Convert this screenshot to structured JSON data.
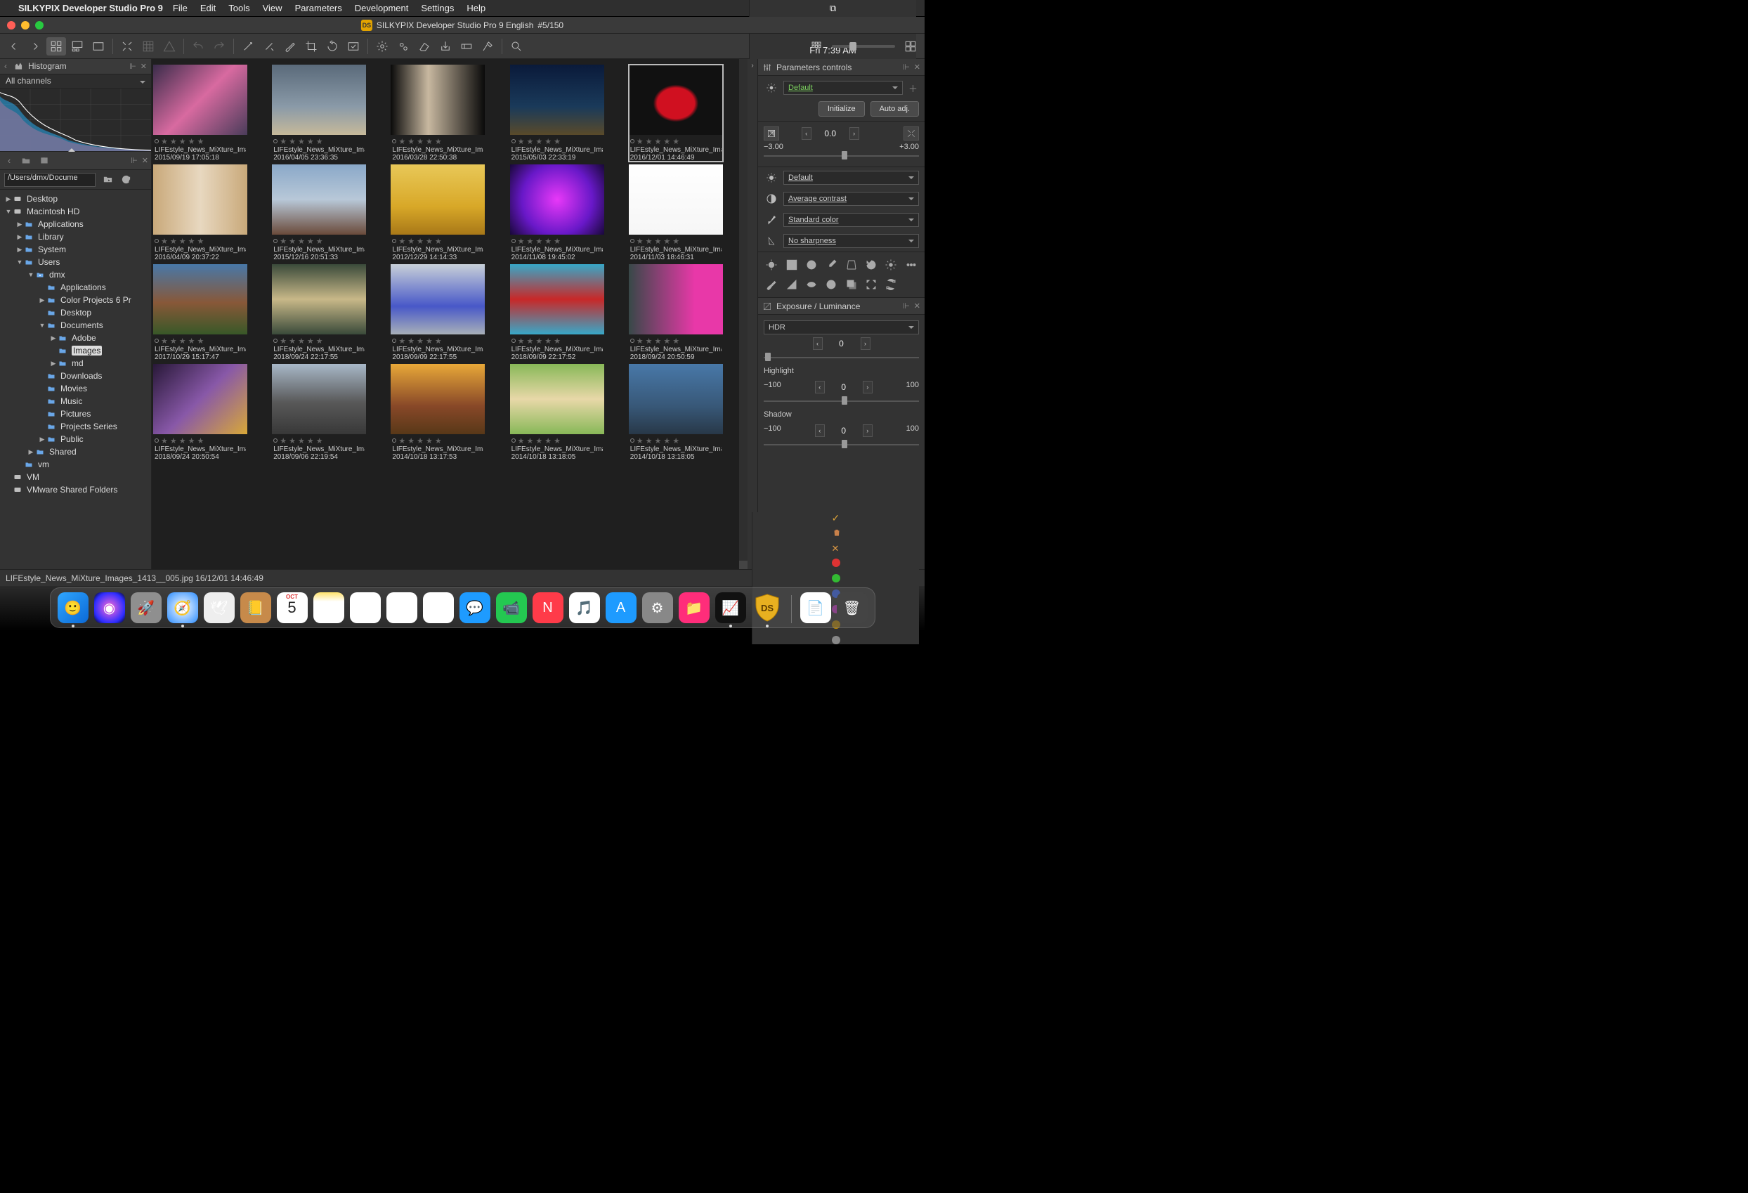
{
  "menubar": {
    "apple": "",
    "app": "SILKYPIX Developer Studio Pro 9",
    "items": [
      "File",
      "Edit",
      "Tools",
      "View",
      "Parameters",
      "Development",
      "Settings",
      "Help"
    ],
    "clock": "Fri 7:39 AM"
  },
  "titlebar": {
    "title": "SILKYPIX Developer Studio Pro 9 English",
    "counter": "#5/150",
    "appicon": "DS"
  },
  "left": {
    "histogram": {
      "title": "Histogram",
      "mode": "All channels"
    },
    "path": "/Users/dmx/Docume",
    "tree": [
      {
        "d": 0,
        "a": "▶",
        "t": "disk",
        "l": "Desktop"
      },
      {
        "d": 0,
        "a": "▼",
        "t": "disk",
        "l": "Macintosh HD"
      },
      {
        "d": 1,
        "a": "▶",
        "t": "folder",
        "l": "Applications"
      },
      {
        "d": 1,
        "a": "▶",
        "t": "folder",
        "l": "Library"
      },
      {
        "d": 1,
        "a": "▶",
        "t": "folder",
        "l": "System"
      },
      {
        "d": 1,
        "a": "▼",
        "t": "folder",
        "l": "Users"
      },
      {
        "d": 2,
        "a": "▼",
        "t": "user",
        "l": "dmx"
      },
      {
        "d": 3,
        "a": "",
        "t": "folder",
        "l": "Applications"
      },
      {
        "d": 3,
        "a": "▶",
        "t": "folder",
        "l": "Color Projects 6 Pr"
      },
      {
        "d": 3,
        "a": "",
        "t": "folder",
        "l": "Desktop"
      },
      {
        "d": 3,
        "a": "▼",
        "t": "folder",
        "l": "Documents"
      },
      {
        "d": 4,
        "a": "▶",
        "t": "folder",
        "l": "Adobe"
      },
      {
        "d": 4,
        "a": "",
        "t": "folder",
        "l": "Images",
        "sel": true
      },
      {
        "d": 4,
        "a": "▶",
        "t": "folder",
        "l": "md"
      },
      {
        "d": 3,
        "a": "",
        "t": "folder",
        "l": "Downloads"
      },
      {
        "d": 3,
        "a": "",
        "t": "folder",
        "l": "Movies"
      },
      {
        "d": 3,
        "a": "",
        "t": "folder",
        "l": "Music"
      },
      {
        "d": 3,
        "a": "",
        "t": "folder",
        "l": "Pictures"
      },
      {
        "d": 3,
        "a": "",
        "t": "folder",
        "l": "Projects Series"
      },
      {
        "d": 3,
        "a": "▶",
        "t": "folder",
        "l": "Public"
      },
      {
        "d": 2,
        "a": "▶",
        "t": "folder",
        "l": "Shared"
      },
      {
        "d": 1,
        "a": "",
        "t": "folder",
        "l": "vm"
      },
      {
        "d": 0,
        "a": "",
        "t": "disk",
        "l": "VM"
      },
      {
        "d": 0,
        "a": "",
        "t": "disk",
        "l": "VMware Shared Folders"
      }
    ]
  },
  "thumbnails": [
    {
      "name": "LIFEstyle_News_MiXture_Image",
      "date": "2015/09/19 17:05:18",
      "style": "abstract-pink"
    },
    {
      "name": "LIFEstyle_News_MiXture_Image",
      "date": "2016/04/05 23:36:35",
      "style": "beach-woman"
    },
    {
      "name": "LIFEstyle_News_MiXture_Image",
      "date": "2016/03/28 22:50:38",
      "style": "woman-dark"
    },
    {
      "name": "LIFEstyle_News_MiXture_Image",
      "date": "2015/05/03 22:33:19",
      "style": "night-sky"
    },
    {
      "name": "LIFEstyle_News_MiXture_Image",
      "date": "2016/12/01 14:46:49",
      "style": "red-car",
      "sel": true
    },
    {
      "name": "LIFEstyle_News_MiXture_Image",
      "date": "2016/04/09 20:37:22",
      "style": "cat"
    },
    {
      "name": "LIFEstyle_News_MiXture_Image",
      "date": "2015/12/16 20:51:33",
      "style": "woman-car"
    },
    {
      "name": "LIFEstyle_News_MiXture_Image",
      "date": "2012/12/29 14:14:33",
      "style": "desert"
    },
    {
      "name": "LIFEstyle_News_MiXture_Image",
      "date": "2014/11/08 19:45:02",
      "style": "purple-swirl"
    },
    {
      "name": "LIFEstyle_News_MiXture_Image",
      "date": "2014/11/03 18:46:31",
      "style": "dancers-white"
    },
    {
      "name": "LIFEstyle_News_MiXture_Image",
      "date": "2017/10/29 15:17:47",
      "style": "temple"
    },
    {
      "name": "LIFEstyle_News_MiXture_Image",
      "date": "2018/09/24 22:17:55",
      "style": "blonde-water"
    },
    {
      "name": "LIFEstyle_News_MiXture_Image",
      "date": "2018/09/09 22:17:55",
      "style": "blue-pose"
    },
    {
      "name": "LIFEstyle_News_MiXture_Image",
      "date": "2018/09/09 22:17:52",
      "style": "red-woman"
    },
    {
      "name": "LIFEstyle_News_MiXture_Image",
      "date": "2018/09/24 20:50:59",
      "style": "rain-magenta"
    },
    {
      "name": "LIFEstyle_News_MiXture_Image",
      "date": "2018/09/24 20:50:54",
      "style": "fantasy"
    },
    {
      "name": "LIFEstyle_News_MiXture_Image",
      "date": "2018/09/06 22:19:54",
      "style": "retro-car"
    },
    {
      "name": "LIFEstyle_News_MiXture_Image",
      "date": "2014/10/18 13:17:53",
      "style": "sunset-road"
    },
    {
      "name": "LIFEstyle_News_MiXture_Image",
      "date": "2014/10/18 13:18:05",
      "style": "native"
    },
    {
      "name": "LIFEstyle_News_MiXture_Image",
      "date": "2014/10/18 13:18:05",
      "style": "building"
    }
  ],
  "right": {
    "title": "Parameters controls",
    "preset": "Default",
    "btn_init": "Initialize",
    "btn_auto": "Auto adj.",
    "ev": {
      "value": "0.0",
      "min": "−3.00",
      "max": "+3.00"
    },
    "dd": [
      {
        "icon": "wb",
        "label": "Default"
      },
      {
        "icon": "contrast",
        "label": "Average contrast"
      },
      {
        "icon": "color",
        "label": "Standard color"
      },
      {
        "icon": "sharp",
        "label": "No sharpness"
      }
    ],
    "lum": {
      "title": "Exposure / Luminance",
      "hdr": {
        "label": "HDR",
        "value": "0"
      },
      "hl": {
        "label": "Highlight",
        "min": "−100",
        "value": "0",
        "max": "100"
      },
      "sh": {
        "label": "Shadow",
        "min": "−100",
        "value": "0",
        "max": "100"
      }
    }
  },
  "status": {
    "file": "LIFEstyle_News_MiXture_Images_1413__005.jpg 16/12/01 14:46:49"
  },
  "dock": [
    {
      "name": "finder",
      "bg": "linear-gradient(135deg,#2fa6ff,#0b69d6)",
      "glyph": "🙂",
      "dot": true
    },
    {
      "name": "siri",
      "bg": "radial-gradient(circle,#ff6bd6,#2d2dff 70%,#000)",
      "glyph": "◉"
    },
    {
      "name": "launchpad",
      "bg": "#8f8f8f",
      "glyph": "🚀"
    },
    {
      "name": "safari",
      "bg": "radial-gradient(circle,#fff,#2a8cff)",
      "glyph": "🧭",
      "dot": true
    },
    {
      "name": "mail",
      "bg": "#eee",
      "glyph": "🕊"
    },
    {
      "name": "contacts",
      "bg": "#c78a4a",
      "glyph": "📒"
    },
    {
      "name": "calendar",
      "bg": "#fff",
      "glyph": "5",
      "text": "OCT",
      "cal": true
    },
    {
      "name": "notes",
      "bg": "linear-gradient(#ffe26a,#fff 30%)",
      "glyph": ""
    },
    {
      "name": "reminders",
      "bg": "#fff",
      "glyph": "▤"
    },
    {
      "name": "maps",
      "bg": "#fff",
      "glyph": "🗺"
    },
    {
      "name": "photos",
      "bg": "#fff",
      "glyph": "❋"
    },
    {
      "name": "messages",
      "bg": "#1e9bff",
      "glyph": "💬"
    },
    {
      "name": "facetime",
      "bg": "#24c851",
      "glyph": "📹"
    },
    {
      "name": "news",
      "bg": "#ff3b49",
      "glyph": "N"
    },
    {
      "name": "music",
      "bg": "#fff",
      "glyph": "🎵"
    },
    {
      "name": "appstore",
      "bg": "#1e9bff",
      "glyph": "A"
    },
    {
      "name": "settings",
      "bg": "#888",
      "glyph": "⚙"
    },
    {
      "name": "cleaner",
      "bg": "#ff2d7a",
      "glyph": "📁"
    },
    {
      "name": "activity",
      "bg": "#111",
      "glyph": "📈",
      "dot": true
    },
    {
      "name": "silkypix",
      "bg": "#e2a300",
      "glyph": "DS",
      "shield": true,
      "dot": true
    },
    {
      "name": "sep"
    },
    {
      "name": "docs",
      "bg": "#fff",
      "glyph": "📄"
    },
    {
      "name": "trash",
      "bg": "#444",
      "glyph": "🗑"
    }
  ]
}
